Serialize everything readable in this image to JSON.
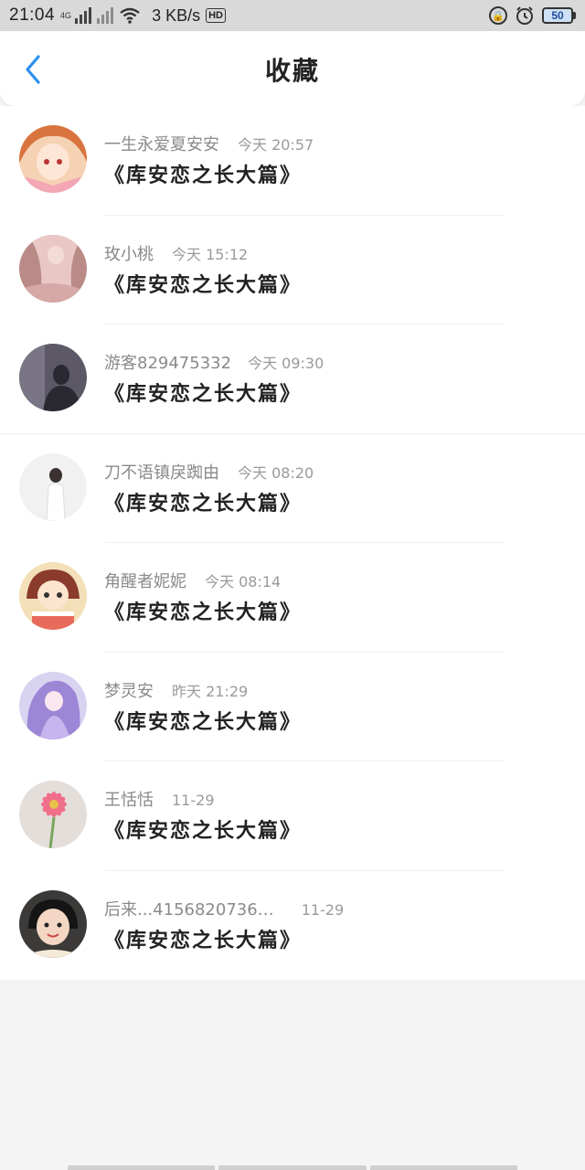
{
  "status_bar": {
    "time": "21:04",
    "network_type": "4G",
    "speed": "3 KB/s",
    "hd_label": "HD",
    "battery": "50"
  },
  "header": {
    "title": "收藏"
  },
  "favorites": [
    {
      "author": "一生永爱夏安安",
      "time": "今天 20:57",
      "title": "《库安恋之长大篇》",
      "avatar": "anime-girl-orange-hair"
    },
    {
      "author": "玫小桃",
      "time": "今天 15:12",
      "title": "《库安恋之长大篇》",
      "avatar": "anime-girl-pink-dress"
    },
    {
      "author": "游客829475332",
      "time": "今天 09:30",
      "title": "《库安恋之长大篇》",
      "avatar": "dark-silhouette"
    },
    {
      "author": "刀不语镇戾踟由",
      "time": "今天 08:20",
      "title": "《库安恋之长大篇》",
      "avatar": "boy-in-white"
    },
    {
      "author": "角醒者妮妮",
      "time": "今天 08:14",
      "title": "《库安恋之长大篇》",
      "avatar": "chibi-girl-cake"
    },
    {
      "author": "梦灵安",
      "time": "昨天 21:29",
      "title": "《库安恋之长大篇》",
      "avatar": "anime-girl-purple-hair"
    },
    {
      "author": "王恬恬",
      "time": "11-29",
      "title": "《库安恋之长大篇》",
      "avatar": "pink-gerbera-flower"
    },
    {
      "author": "后来...4156820736…",
      "time": "11-29",
      "title": "《库安恋之长大篇》",
      "avatar": "child-photo"
    }
  ]
}
